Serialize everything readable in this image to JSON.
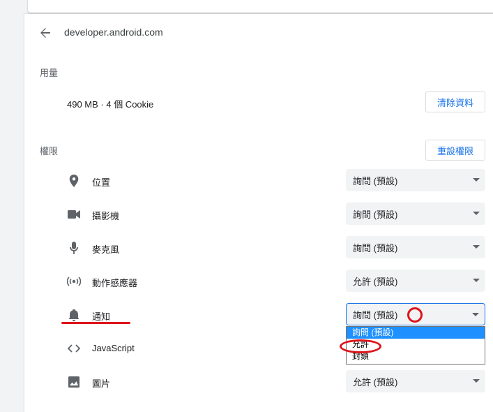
{
  "header": {
    "back_label": "←",
    "site": "developer.android.com"
  },
  "usage": {
    "section_label": "用量",
    "summary": "490 MB · 4 個 Cookie",
    "clear_button": "清除資料"
  },
  "permissions": {
    "section_label": "權限",
    "reset_button": "重設權限",
    "items": [
      {
        "icon": "location-pin-icon",
        "label": "位置",
        "value": "詢問 (預設)"
      },
      {
        "icon": "camera-icon",
        "label": "攝影機",
        "value": "詢問 (預設)"
      },
      {
        "icon": "microphone-icon",
        "label": "麥克風",
        "value": "詢問 (預設)"
      },
      {
        "icon": "motion-sensor-icon",
        "label": "動作感應器",
        "value": "允許 (預設)"
      },
      {
        "icon": "bell-icon",
        "label": "通知",
        "value": "詢問 (預設)"
      },
      {
        "icon": "code-icon",
        "label": "JavaScript",
        "value": ""
      },
      {
        "icon": "image-icon",
        "label": "圖片",
        "value": "允許 (預設)"
      }
    ]
  },
  "notification_dropdown": {
    "options": [
      "詢問 (預設)",
      "允許",
      "封鎖"
    ],
    "highlighted_index": 0
  },
  "annotation_color": "#e0131b",
  "accent_color": "#1a73e8"
}
